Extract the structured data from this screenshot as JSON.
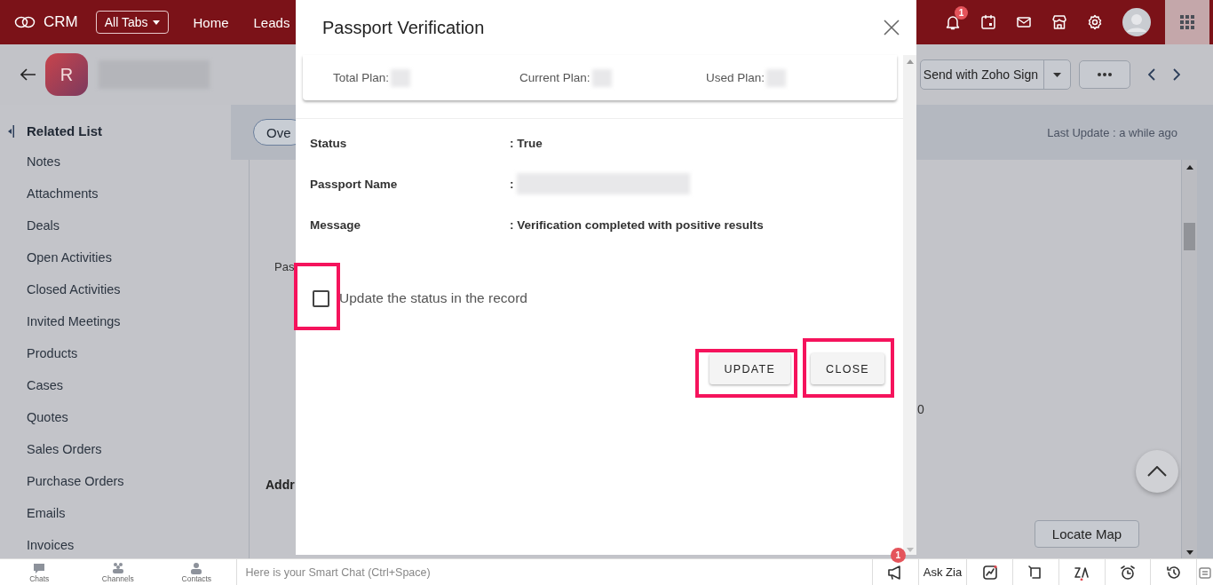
{
  "top_nav": {
    "app_name": "CRM",
    "all_tabs": "All Tabs",
    "tabs": [
      {
        "label": "Home"
      },
      {
        "label": "Leads"
      }
    ],
    "notification_count": "1"
  },
  "record_header": {
    "avatar_letter": "R",
    "sign_button": "Send with Zoho Sign"
  },
  "sidebar": {
    "title": "Related List",
    "items": [
      "Notes",
      "Attachments",
      "Deals",
      "Open Activities",
      "Closed Activities",
      "Invited Meetings",
      "Products",
      "Cases",
      "Quotes",
      "Sales Orders",
      "Purchase Orders",
      "Emails",
      "Invoices"
    ]
  },
  "record_tabs": [
    {
      "label": "Ove",
      "selected": true
    }
  ],
  "last_update": "Last Update : a while ago",
  "field_label_cut": "Pas",
  "section_heading_cut": "Addr",
  "field_value_cut": "0",
  "locate_map": "Locate Map",
  "dialog": {
    "title": "Passport Verification",
    "plans": [
      "Total Plan:",
      "Current Plan:",
      "Used Plan:"
    ],
    "results": [
      {
        "label": "Status",
        "value": ": True"
      },
      {
        "label": "Passport Name",
        "value": ":"
      },
      {
        "label": "Message",
        "value": ": Verification completed with positive results"
      }
    ],
    "checkbox": {
      "label": "Update the status in the record",
      "checked": false,
      "highlighted": true
    },
    "buttons": [
      {
        "label": "UPDATE",
        "highlighted": true
      },
      {
        "label": "CLOSE",
        "highlighted": true
      }
    ]
  },
  "bottom_bar": {
    "apps": [
      "Chats",
      "Channels",
      "Contacts"
    ],
    "chat_placeholder": "Here is your Smart Chat (Ctrl+Space)",
    "badge": "1",
    "ask_zia": "Ask Zia"
  }
}
